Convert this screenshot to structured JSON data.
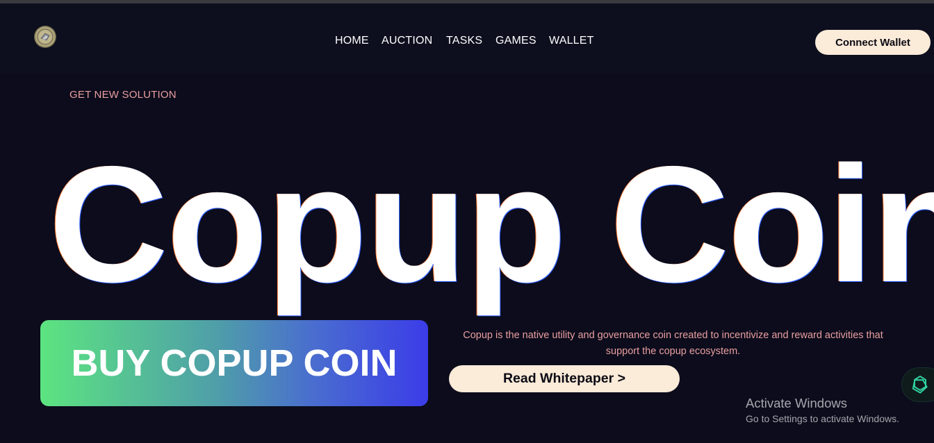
{
  "header": {
    "logo_icon": "copup-coin-logo-icon",
    "nav": [
      {
        "label": "HOME"
      },
      {
        "label": "AUCTION"
      },
      {
        "label": "TASKS"
      },
      {
        "label": "GAMES"
      },
      {
        "label": "WALLET"
      }
    ],
    "connect_label": "Connect Wallet"
  },
  "hero": {
    "eyebrow": "GET NEW SOLUTION",
    "title": "Copup Coin",
    "buy_label": "BUY COPUP COIN",
    "description": "Copup is the native utility and governance coin created to incentivize and reward activities that support the copup ecosystem.",
    "whitepaper_label": "Read Whitepaper >"
  },
  "widget": {
    "icon": "ai-assistant-icon"
  },
  "watermark": {
    "title": "Activate Windows",
    "subtitle": "Go to Settings to activate Windows."
  },
  "colors": {
    "background": "#0c0c1c",
    "header_background": "#0d0f1e",
    "accent_pink": "#ea9fa0",
    "button_cream": "#fbebd9",
    "gradient_start": "#5ce480",
    "gradient_end": "#3b3ce8"
  }
}
